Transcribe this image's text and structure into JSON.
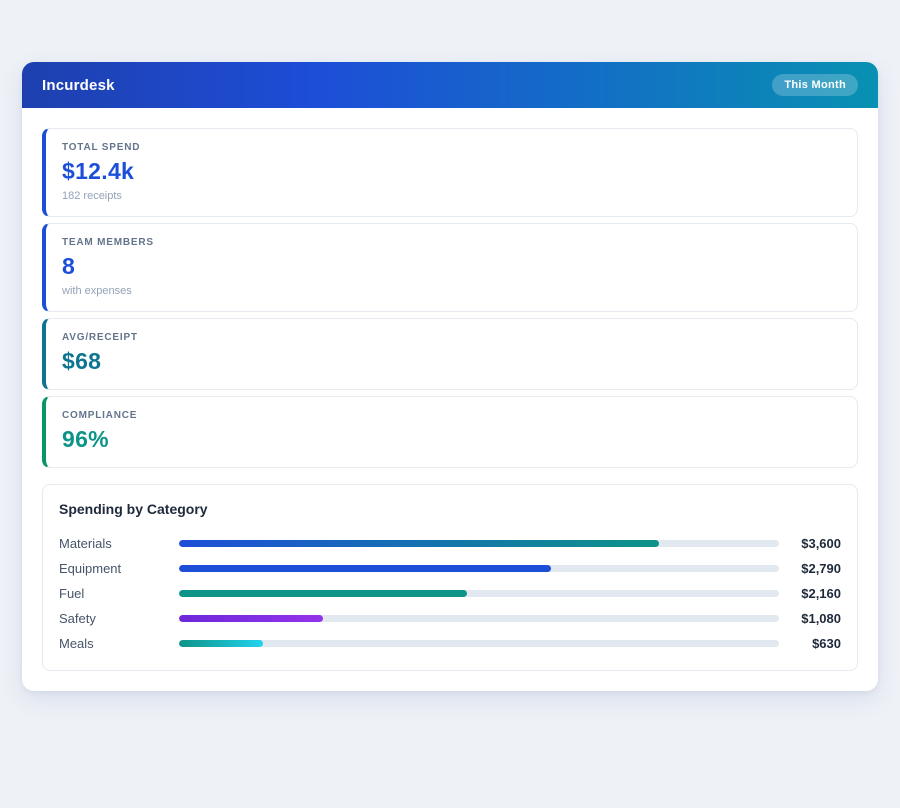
{
  "header": {
    "title": "Incurdesk",
    "badge": "This Month"
  },
  "stats": [
    {
      "label": "TOTAL SPEND",
      "value": "$12.4k",
      "sub": "182 receipts",
      "accent": "#1d4ed8",
      "value_color": "#1d4ed8"
    },
    {
      "label": "TEAM MEMBERS",
      "value": "8",
      "sub": "with expenses",
      "accent": "#1d4ed8",
      "value_color": "#1d4ed8"
    },
    {
      "label": "AVG/RECEIPT",
      "value": "$68",
      "sub": "",
      "accent": "#0e7490",
      "value_color": "#0e7490"
    },
    {
      "label": "COMPLIANCE",
      "value": "96%",
      "sub": "",
      "accent": "#059669",
      "value_color": "#0d9488"
    }
  ],
  "chart_data": {
    "type": "bar",
    "title": "Spending by Category",
    "categories": [
      "Materials",
      "Equipment",
      "Fuel",
      "Safety",
      "Meals"
    ],
    "values": [
      3600,
      2790,
      2160,
      1080,
      630
    ],
    "value_labels": [
      "$3,600",
      "$2,790",
      "$2,160",
      "$1,080",
      "$630"
    ],
    "xlim": [
      0,
      4500
    ],
    "xlabel": "",
    "ylabel": "",
    "grid": false,
    "legend": "none",
    "track_color": "#e2e8f0",
    "bar_colors": [
      [
        "#1d4ed8",
        "#0d9488"
      ],
      [
        "#1d4ed8",
        "#1d4ed8"
      ],
      [
        "#0d9488",
        "#0d9488"
      ],
      [
        "#6d28d9",
        "#9333ea"
      ],
      [
        "#0d9488",
        "#22d3ee"
      ]
    ]
  }
}
